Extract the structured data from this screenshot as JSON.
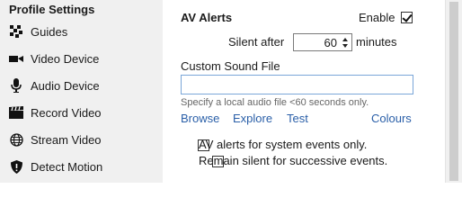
{
  "sidebar": {
    "title": "Profile Settings",
    "items": [
      {
        "label": "Guides",
        "icon": "guides-icon"
      },
      {
        "label": "Video Device",
        "icon": "video-camera-icon"
      },
      {
        "label": "Audio Device",
        "icon": "microphone-icon"
      },
      {
        "label": "Record Video",
        "icon": "clapperboard-icon"
      },
      {
        "label": "Stream Video",
        "icon": "globe-icon"
      },
      {
        "label": "Detect Motion",
        "icon": "shield-icon"
      }
    ]
  },
  "av_alerts": {
    "title": "AV Alerts",
    "enable_label": "Enable",
    "enable_checked": true,
    "silent_after_label": "Silent after",
    "silent_after_value": "60",
    "minutes_label": "minutes",
    "custom_sound_label": "Custom Sound File",
    "custom_sound_value": "",
    "hint": "Specify a local audio file <60 seconds only.",
    "links": {
      "browse": "Browse",
      "explore": "Explore",
      "test": "Test",
      "colours": "Colours"
    },
    "options": [
      {
        "label": "AV alerts for system events only.",
        "checked": false
      },
      {
        "label": "Remain silent for successive events.",
        "checked": false
      }
    ]
  }
}
